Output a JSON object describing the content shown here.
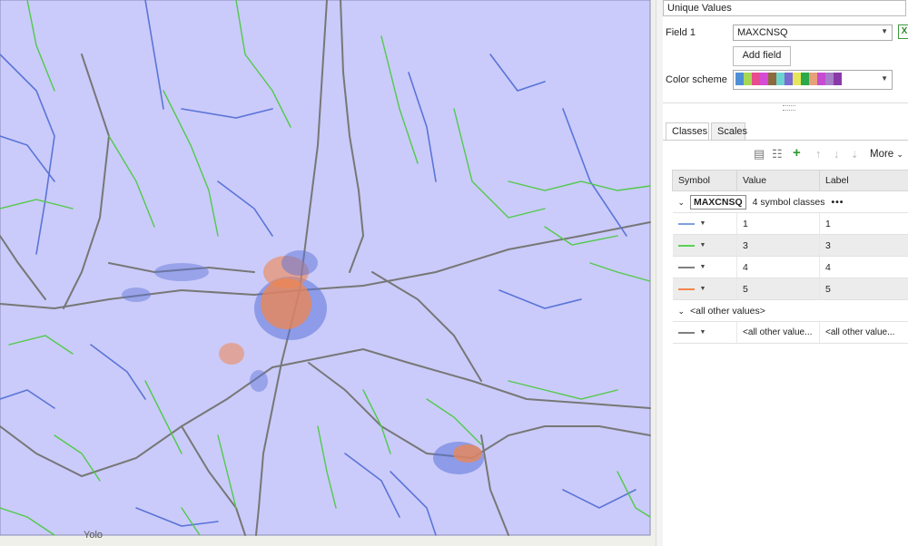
{
  "map": {
    "place_label": "Yolo",
    "fill_color": "#cacbfa",
    "class_colors": {
      "c1": "#5b74d8",
      "c3": "#52c94a",
      "c4": "#777777",
      "c5": "#f0864e"
    }
  },
  "symbology": {
    "renderer": "Unique Values",
    "field1_label": "Field 1",
    "field1_value": "MAXCNSQ",
    "add_field_label": "Add field",
    "color_scheme_label": "Color scheme",
    "color_scheme": [
      "#4f8fd6",
      "#a6d854",
      "#e74c8c",
      "#d64bd6",
      "#8b6a3c",
      "#6dd3cf",
      "#7b6bd3",
      "#e6e65a",
      "#2aa84a",
      "#e8a07a",
      "#c64bd2",
      "#a77fc8",
      "#8a3aa8"
    ],
    "tabs": [
      "Classes",
      "Scales"
    ],
    "more_label": "More",
    "columns": [
      "Symbol",
      "Value",
      "Label"
    ],
    "group_field": "MAXCNSQ",
    "group_summary": "4 symbol classes",
    "classes": [
      {
        "color": "#7fa0e0",
        "value": "1",
        "label": "1"
      },
      {
        "color": "#5bd155",
        "value": "3",
        "label": "3"
      },
      {
        "color": "#808080",
        "value": "4",
        "label": "4"
      },
      {
        "color": "#f0864e",
        "value": "5",
        "label": "5"
      }
    ],
    "other_group": "<all other values>",
    "other_row": {
      "color": "#808080",
      "value": "<all other value...",
      "label": "<all other value..."
    }
  }
}
